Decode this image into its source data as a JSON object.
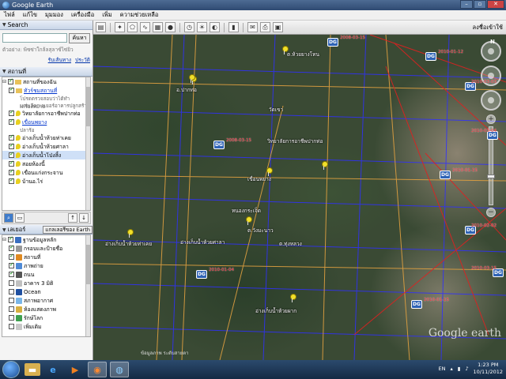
{
  "window": {
    "title": "Google Earth"
  },
  "menu": [
    "ไฟล์",
    "แก้ไข",
    "มุมมอง",
    "เครื่องมือ",
    "เพิ่ม",
    "ความช่วยเหลือ"
  ],
  "toolbar": {
    "signin": "ลงชื่อเข้าใช้"
  },
  "search": {
    "header": "Search",
    "button": "ค้นหา",
    "placeholder": "",
    "hint": "ตัวอย่าง: พิซซ่าใกล้ลสุลาซ์ไซ่ยิว",
    "link_directions": "รับเส้นทาง",
    "link_history": "ประวัติ"
  },
  "places": {
    "header": "สถานที่",
    "items": [
      {
        "label": "สถานที่ของฉัน",
        "type": "folder",
        "checked": true,
        "level": 0
      },
      {
        "label": "ทัวร์ชมสถานที่",
        "type": "link",
        "checked": true,
        "level": 1
      },
      {
        "label": "โปรดตรวจสอบว่าได้ทำเครื่องหมาย",
        "type": "desc"
      },
      {
        "label": "มายเลือกเลเยอร์อาคารปลูกสร้าง",
        "type": "desc"
      },
      {
        "label": "วิทยาลัยการอาชีพปากท่อ",
        "type": "pin",
        "checked": true,
        "level": 1
      },
      {
        "label": "เขื่อนพยาง",
        "type": "link",
        "checked": true,
        "level": 1
      },
      {
        "label": "ปลาร้อ",
        "type": "desc"
      },
      {
        "label": "อ่างเก็บน้ำห้วยท่าเคย",
        "type": "pin",
        "checked": true,
        "level": 1
      },
      {
        "label": "อ่างเก็บน้ำห้วยศาลา",
        "type": "pin",
        "checked": true,
        "level": 1
      },
      {
        "label": "อ่างเก็บน้ำโป่งสิ้ง",
        "type": "pin",
        "checked": true,
        "level": 1,
        "selected": true
      },
      {
        "label": "สอยห้องนี้",
        "type": "pin",
        "checked": true,
        "level": 1
      },
      {
        "label": "เขื่อนแก่งกระจาน",
        "type": "pin",
        "checked": true,
        "level": 1
      },
      {
        "label": "บ้านอ.ไร่",
        "type": "pin",
        "checked": true,
        "level": 1
      }
    ]
  },
  "layers": {
    "header": "เลเยอร์",
    "button": "แกลเลอรีของ Earth",
    "items": [
      {
        "label": "ฐานข้อมูลหลัก",
        "color": "#3a6fc0",
        "checked": true,
        "level": 0
      },
      {
        "label": "กรอบและป้ายชื่อ",
        "color": "#999999",
        "checked": true,
        "level": 1
      },
      {
        "label": "สถานที่",
        "color": "#e08a20",
        "checked": true,
        "level": 1
      },
      {
        "label": "ภาพถ่าย",
        "color": "#4f8ad6",
        "checked": true,
        "level": 1
      },
      {
        "label": "ถนน",
        "color": "#555555",
        "checked": true,
        "level": 1
      },
      {
        "label": "อาคาร 3 มิติ",
        "color": "#c0c0c0",
        "checked": false,
        "level": 1
      },
      {
        "label": "Ocean",
        "color": "#1f4fa0",
        "checked": false,
        "level": 1
      },
      {
        "label": "สภาพอากาศ",
        "color": "#7ab6e8",
        "checked": false,
        "level": 1
      },
      {
        "label": "ห้องแสดงภาพ",
        "color": "#d8b040",
        "checked": false,
        "level": 1
      },
      {
        "label": "รักษ์โลก",
        "color": "#3fa050",
        "checked": false,
        "level": 1
      },
      {
        "label": "เพิ่มเติม",
        "color": "#c8c8c8",
        "checked": false,
        "level": 1
      }
    ]
  },
  "map": {
    "labels": [
      {
        "text": "อ.ปากท่อ",
        "id": "a"
      },
      {
        "text": "ต.ห้วยยางโทน",
        "id": "b"
      },
      {
        "text": "วัดเขา",
        "id": "c"
      },
      {
        "text": "วิทยาลัยการอาชีพปากท่อ",
        "id": "d"
      },
      {
        "text": "เขื่อนพยาง",
        "id": "e"
      },
      {
        "text": "ต.ทุ่งหลวง",
        "id": "f"
      },
      {
        "text": "หนองกระเจ็ด",
        "id": "g"
      },
      {
        "text": "อ่างเก็บน้ำห้วยศาลา",
        "id": "h"
      },
      {
        "text": "อ่างเก็บน้ำห้วยท่าเคย",
        "id": "i"
      },
      {
        "text": "ต.วังมะนาว",
        "id": "j"
      },
      {
        "text": "อ่างเก็บน้ำห้วยผาก",
        "id": "k"
      }
    ],
    "dg_marker": "DG",
    "dg_dates": [
      "2008-03-15",
      "2008-03-15",
      "2010-01-04",
      "2010-01-15",
      "2010-01-15",
      "2010-01-12",
      "2010-02-02",
      "2010-03-15",
      "2010-03-04",
      "2010-03-03"
    ],
    "watermark": "Google earth",
    "status": "ข้อมูลภาพ ระดับสายตา"
  },
  "taskbar": {
    "lang": "EN",
    "time": "1:23 PM",
    "date": "10/11/2012"
  }
}
